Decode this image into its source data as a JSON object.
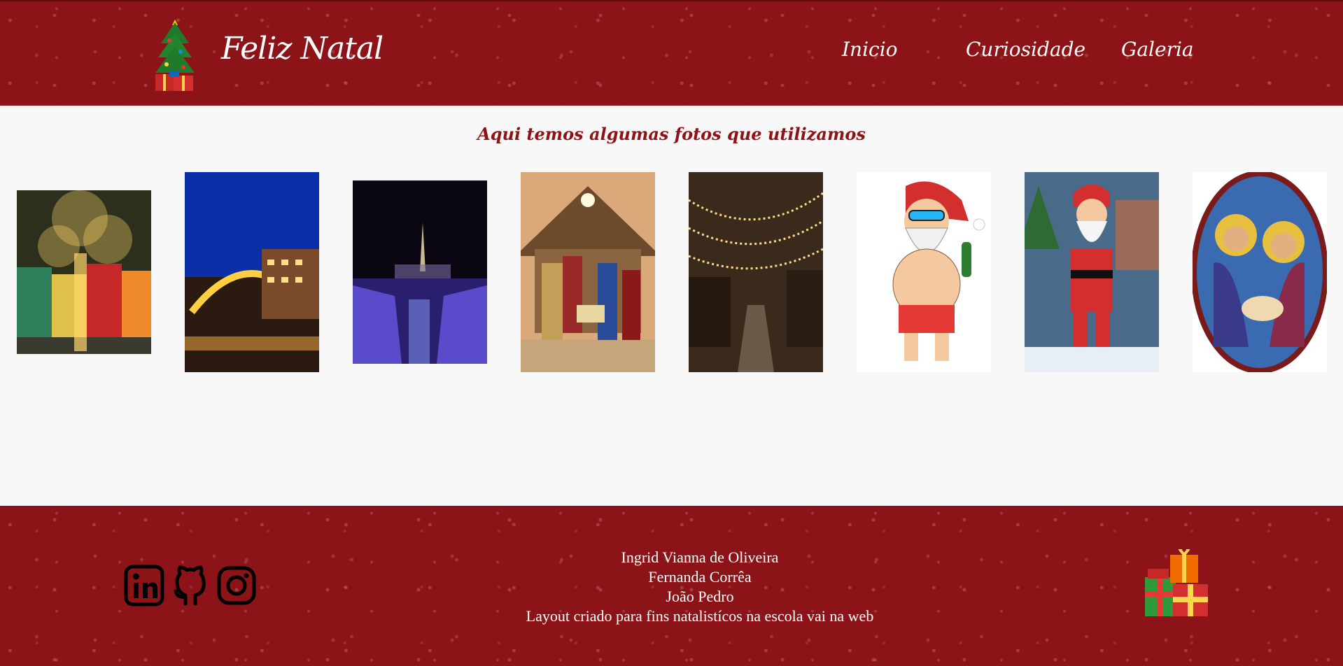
{
  "header": {
    "brand": "Feliz Natal",
    "nav": [
      "Inicio",
      "Curiosidade",
      "Galeria"
    ]
  },
  "gallery": {
    "title": "Aqui temos algumas fotos que utilizamos",
    "photos": [
      "Casas iluminadas com árvore de luzes",
      "Pórtico iluminado de Natal",
      "Igreja e rio iluminados à noite",
      "Presépio com estrela de Belém",
      "Rua com luzes de Natal",
      "Papai Noel de sunga e óculos",
      "Papai Noel com presentes",
      "Vitral da Sagrada Família"
    ]
  },
  "footer": {
    "credits": [
      "Ingrid Vianna de Oliveira",
      "Fernanda Corrêa",
      "João Pedro",
      "Layout criado para fins natalistícos na escola vai na web"
    ],
    "socials": [
      "linkedin-icon",
      "github-icon",
      "instagram-icon"
    ]
  },
  "colors": {
    "brand_red": "#8c1317",
    "background": "#f8f8f8"
  }
}
